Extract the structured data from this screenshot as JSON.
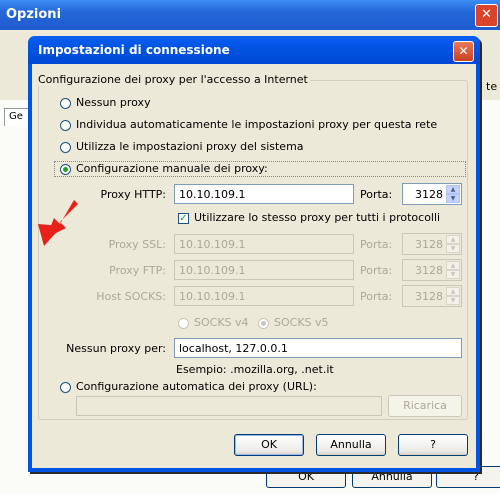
{
  "parent": {
    "title": "Opzioni",
    "close": "✕",
    "tab_label": "Ge",
    "side_text": "te",
    "ok_label": "OK",
    "cancel_label": "Annulla",
    "help_label": "?"
  },
  "dialog": {
    "title": "Impostazioni di connessione",
    "close": "✕",
    "group_label": "Configurazione dei proxy per l'accesso a Internet",
    "options": {
      "no_proxy": "Nessun proxy",
      "auto_detect": "Individua automaticamente le impostazioni proxy per questa rete",
      "system": "Utilizza le impostazioni proxy del sistema",
      "manual": "Configurazione manuale dei proxy:"
    },
    "http": {
      "label": "Proxy HTTP:",
      "value": "10.10.109.1",
      "port_label": "Porta:",
      "port": "3128"
    },
    "same_proxy": "Utilizzare lo stesso proxy per tutti i protocolli",
    "ssl": {
      "label": "Proxy SSL:",
      "value": "10.10.109.1",
      "port_label": "Porta:",
      "port": "3128"
    },
    "ftp": {
      "label": "Proxy FTP:",
      "value": "10.10.109.1",
      "port_label": "Porta:",
      "port": "3128"
    },
    "socks": {
      "label": "Host SOCKS:",
      "value": "10.10.109.1",
      "port_label": "Porta:",
      "port": "3128"
    },
    "socks_v4": "SOCKS v4",
    "socks_v5": "SOCKS v5",
    "no_proxy_for": {
      "label": "Nessun proxy per:",
      "value": "localhost, 127.0.0.1"
    },
    "example": "Esempio: .mozilla.org, .net.it",
    "auto_config": "Configurazione automatica dei proxy (URL):",
    "auto_url": "",
    "reload_label": "Ricarica",
    "ok_label": "OK",
    "cancel_label": "Annulla",
    "help_label": "?"
  },
  "colors": {
    "arrow": "#e8201a",
    "title_bar": "#0054e3",
    "dialog_bg": "#ece9d8"
  }
}
